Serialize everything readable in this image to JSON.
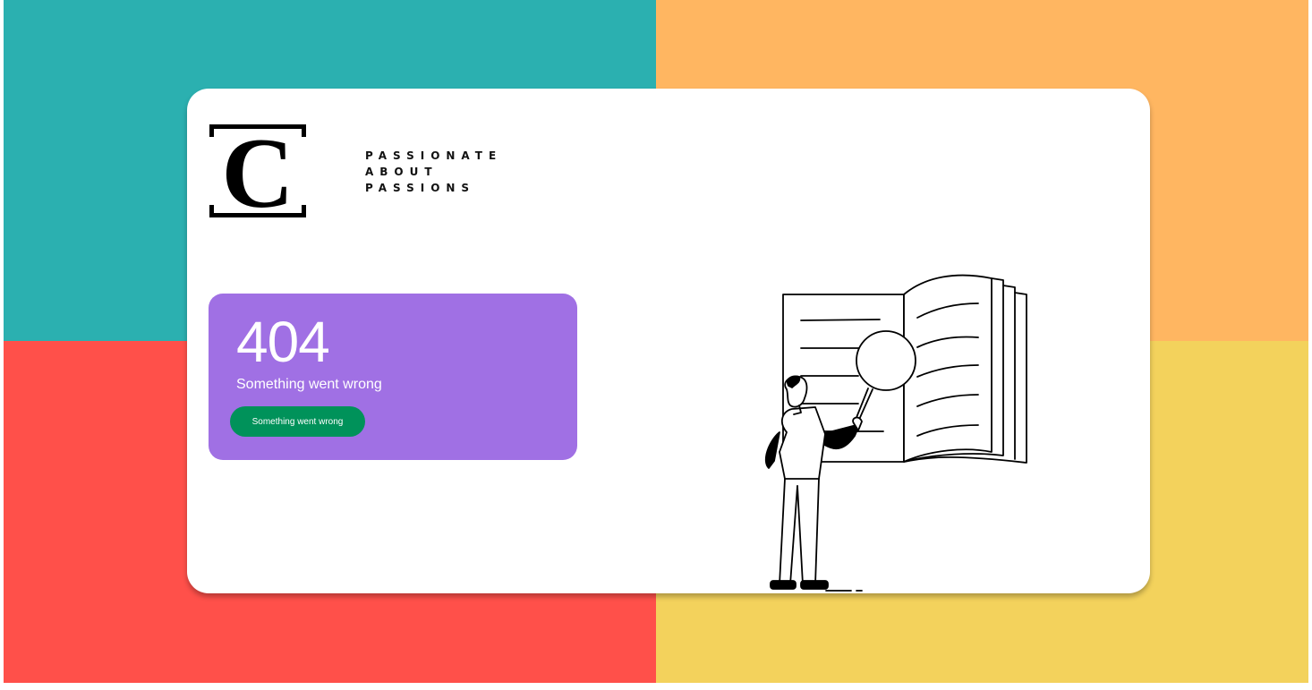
{
  "brand": {
    "logo_letter": "C",
    "tagline": [
      "PASSIONATE",
      "ABOUT",
      "PASSIONS"
    ]
  },
  "error": {
    "code": "404",
    "message": "Something went wrong",
    "button_label": "Something went wrong"
  },
  "colors": {
    "teal": "#2bb0b0",
    "orange": "#ffb661",
    "red": "#ff504a",
    "yellow": "#f3d25c",
    "purple": "#a070e4",
    "green": "#00925a"
  },
  "illustration": {
    "icon": "person-with-magnifying-glass-and-book"
  }
}
